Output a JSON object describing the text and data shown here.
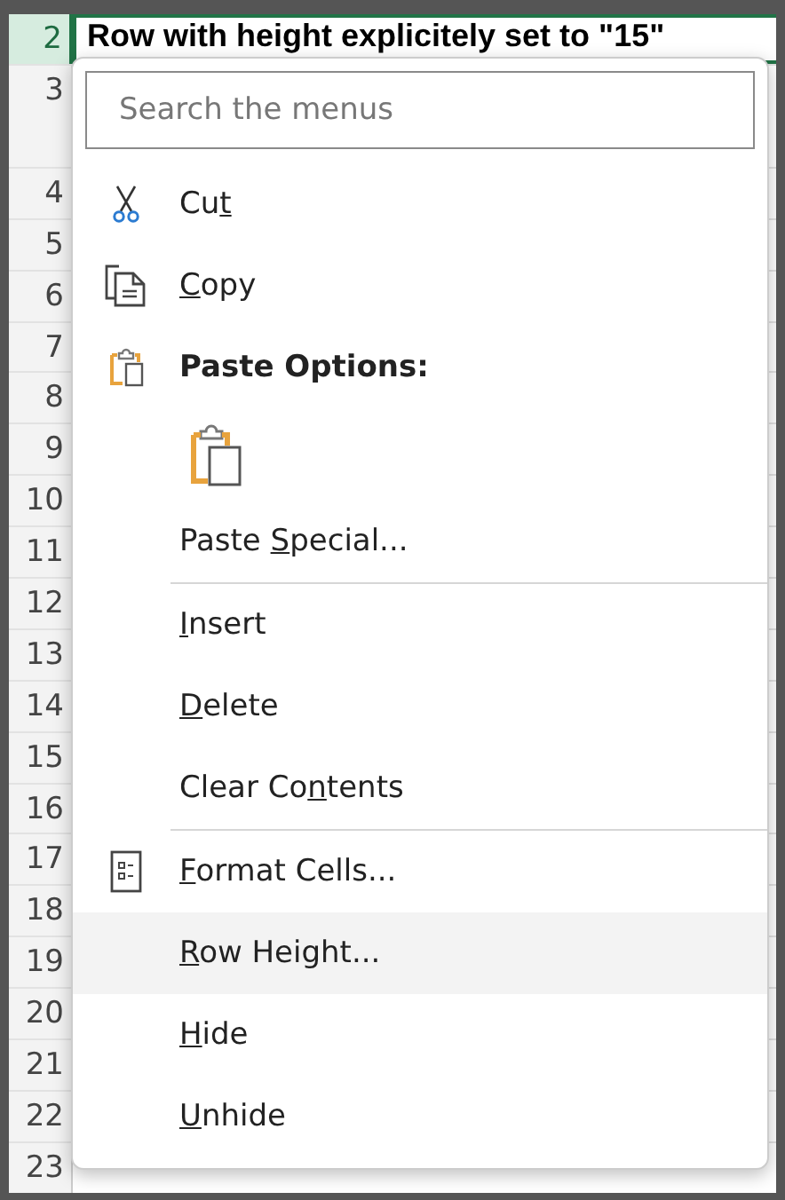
{
  "sheet": {
    "rows": [
      {
        "number": "2",
        "selected": true,
        "tall": false,
        "cell": "Row with height explicitely set to \"15\""
      },
      {
        "number": "3",
        "selected": false,
        "tall": true
      },
      {
        "number": "4",
        "selected": false,
        "tall": false
      },
      {
        "number": "5",
        "selected": false,
        "tall": false
      },
      {
        "number": "6",
        "selected": false,
        "tall": false
      },
      {
        "number": "7",
        "selected": false,
        "tall": false
      },
      {
        "number": "8",
        "selected": false,
        "tall": false
      },
      {
        "number": "9",
        "selected": false,
        "tall": false
      },
      {
        "number": "10",
        "selected": false,
        "tall": false
      },
      {
        "number": "11",
        "selected": false,
        "tall": false
      },
      {
        "number": "12",
        "selected": false,
        "tall": false
      },
      {
        "number": "13",
        "selected": false,
        "tall": false
      },
      {
        "number": "14",
        "selected": false,
        "tall": false
      },
      {
        "number": "15",
        "selected": false,
        "tall": false
      },
      {
        "number": "16",
        "selected": false,
        "tall": false
      },
      {
        "number": "17",
        "selected": false,
        "tall": false
      },
      {
        "number": "18",
        "selected": false,
        "tall": false
      },
      {
        "number": "19",
        "selected": false,
        "tall": false
      },
      {
        "number": "20",
        "selected": false,
        "tall": false
      },
      {
        "number": "21",
        "selected": false,
        "tall": false
      },
      {
        "number": "22",
        "selected": false,
        "tall": false
      },
      {
        "number": "23",
        "selected": false,
        "tall": false
      }
    ]
  },
  "context_menu": {
    "search": {
      "placeholder": "Search the menus"
    },
    "items": [
      {
        "kind": "item",
        "highlighted": false,
        "label_parts": [
          {
            "text": "Cu",
            "underlined": false
          },
          {
            "text": "t",
            "underlined": true
          }
        ]
      },
      {
        "kind": "item",
        "highlighted": false,
        "label_parts": [
          {
            "text": "C",
            "underlined": true
          },
          {
            "text": "opy",
            "underlined": false
          }
        ]
      },
      {
        "kind": "header",
        "label": "Paste Options:"
      },
      {
        "kind": "paste-icons"
      },
      {
        "kind": "item",
        "highlighted": false,
        "label_parts": [
          {
            "text": "Paste ",
            "underlined": false
          },
          {
            "text": "S",
            "underlined": true
          },
          {
            "text": "pecial...",
            "underlined": false
          }
        ]
      },
      {
        "kind": "divider"
      },
      {
        "kind": "item",
        "highlighted": false,
        "label_parts": [
          {
            "text": "I",
            "underlined": true
          },
          {
            "text": "nsert",
            "underlined": false
          }
        ]
      },
      {
        "kind": "item",
        "highlighted": false,
        "label_parts": [
          {
            "text": "D",
            "underlined": true
          },
          {
            "text": "elete",
            "underlined": false
          }
        ]
      },
      {
        "kind": "item",
        "highlighted": false,
        "label_parts": [
          {
            "text": "Clear Co",
            "underlined": false
          },
          {
            "text": "n",
            "underlined": true
          },
          {
            "text": "tents",
            "underlined": false
          }
        ]
      },
      {
        "kind": "divider"
      },
      {
        "kind": "item",
        "highlighted": false,
        "label_parts": [
          {
            "text": "F",
            "underlined": true
          },
          {
            "text": "ormat Cells...",
            "underlined": false
          }
        ]
      },
      {
        "kind": "item",
        "highlighted": true,
        "label_parts": [
          {
            "text": "R",
            "underlined": true
          },
          {
            "text": "ow Height...",
            "underlined": false
          }
        ]
      },
      {
        "kind": "item",
        "highlighted": false,
        "label_parts": [
          {
            "text": "H",
            "underlined": true
          },
          {
            "text": "ide",
            "underlined": false
          }
        ]
      },
      {
        "kind": "item",
        "highlighted": false,
        "label_parts": [
          {
            "text": "U",
            "underlined": true
          },
          {
            "text": "nhide",
            "underlined": false
          }
        ]
      }
    ]
  }
}
